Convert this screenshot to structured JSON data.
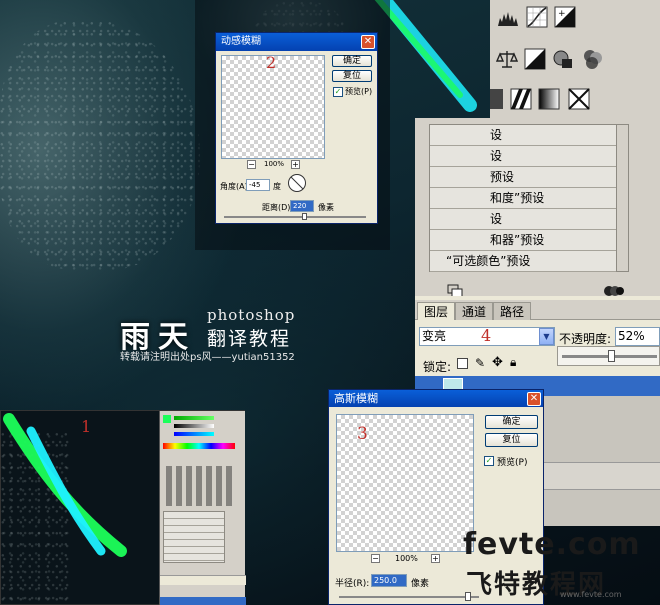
{
  "dialog_motion_blur": {
    "title": "动感模糊",
    "ok_label": "确定",
    "reset_label": "复位",
    "preview_label": "预览(P)",
    "zoom_value": "100%",
    "angle_label": "角度(A):",
    "angle_value": "-45",
    "angle_unit": "度",
    "distance_label": "距离(D):",
    "distance_value": "220",
    "distance_unit": "像素",
    "step_number": "2"
  },
  "dialog_gaussian_blur": {
    "title": "高斯模糊",
    "ok_label": "确定",
    "reset_label": "复位",
    "preview_label": "预览(P)",
    "zoom_value": "100%",
    "radius_label": "半径(R):",
    "radius_value": "250.0",
    "radius_unit": "像素",
    "step_number": "3"
  },
  "adjustment_presets": {
    "items": [
      "设",
      "设",
      "预设",
      "和度”预设",
      "设",
      "和器”预设",
      "“可选颜色”预设"
    ]
  },
  "layers_panel": {
    "tab_layers": "图层",
    "tab_channels": "通道",
    "tab_paths": "路径",
    "blend_mode": "变亮",
    "step_number": "4",
    "opacity_label": "不透明度:",
    "opacity_value": "52%",
    "lock_label": "锁定:",
    "opacity_fraction": 0.52
  },
  "inset": {
    "step_number": "1"
  },
  "watermark": {
    "brand_cn": "雨天",
    "brand_en": "photoshop",
    "subtitle": "翻译教程",
    "repost_note": "转载请注明出处ps风——yutian51352",
    "site_logo": "fevte.com",
    "site_name_cn": "飞特教程网",
    "site_url_small": "www.fevte.com"
  },
  "colors": {
    "xp_title": "#0a5fd8",
    "step_red": "#c0302a",
    "neon_green": "#1cff5a",
    "neon_cyan": "#1ff0ff"
  }
}
